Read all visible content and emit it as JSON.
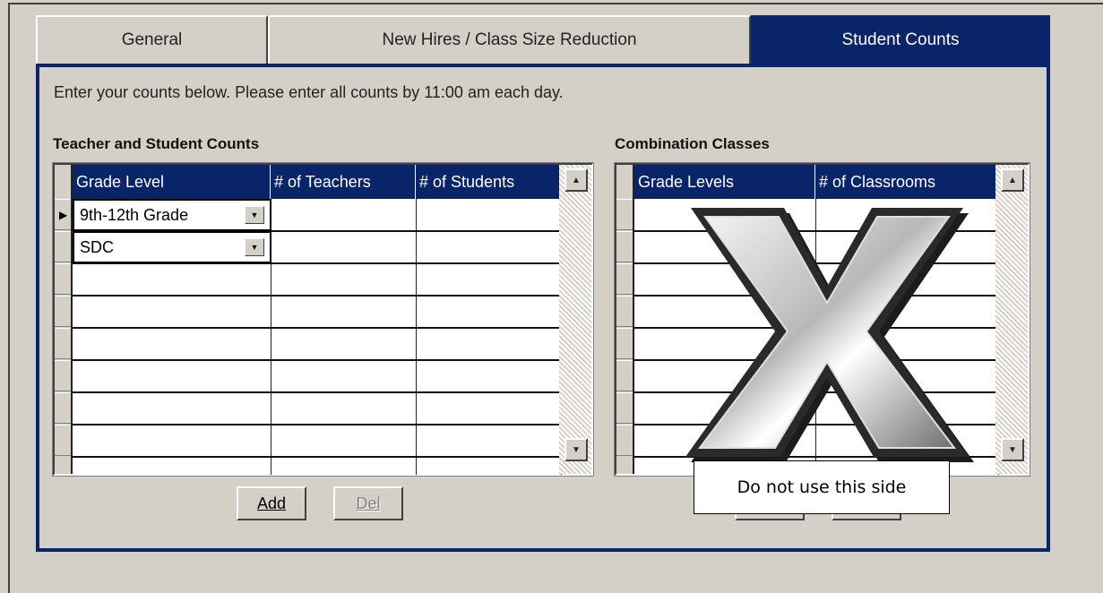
{
  "tabs": [
    {
      "label": "General"
    },
    {
      "label": "New Hires / Class Size Reduction"
    },
    {
      "label": "Student Counts"
    }
  ],
  "instructions": "Enter your counts below.  Please enter all counts by 11:00 am each day.",
  "teacher_section": {
    "title": "Teacher and Student Counts",
    "columns": [
      "Grade Level",
      "# of Teachers",
      "# of Students"
    ],
    "rows": [
      {
        "grade": "9th-12th Grade",
        "teachers": "",
        "students": ""
      },
      {
        "grade": "SDC",
        "teachers": "",
        "students": ""
      }
    ],
    "add_label": "Add",
    "del_label": "Del"
  },
  "combo_section": {
    "title": "Combination Classes",
    "columns": [
      "Grade Levels",
      "# of Classrooms"
    ]
  },
  "overlay": {
    "callout_text": "Do not use this side"
  },
  "colors": {
    "accent": "#0a246a",
    "background": "#d4d0c8"
  }
}
